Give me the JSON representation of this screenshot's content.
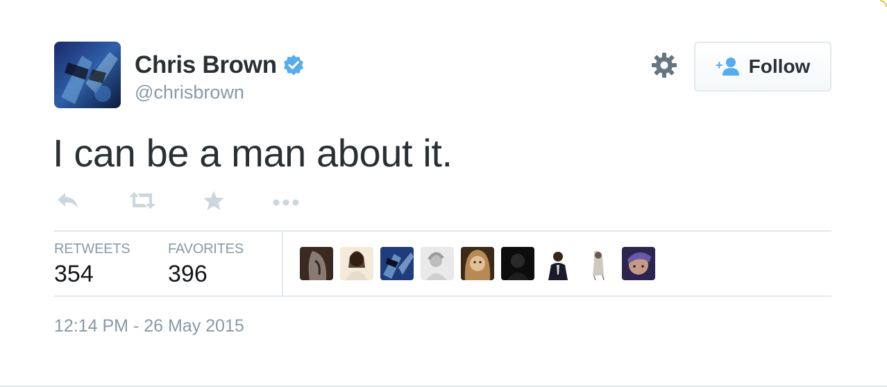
{
  "user": {
    "display_name": "Chris Brown",
    "handle": "@chrisbrown",
    "verified": true,
    "avatar_icon": "profile-photo"
  },
  "follow_button": {
    "label": "Follow",
    "icon": "add-user-icon"
  },
  "settings_icon": "gear-icon",
  "tweet": {
    "text": "I can be a man about it."
  },
  "actions": [
    {
      "name": "reply",
      "icon": "reply-icon"
    },
    {
      "name": "retweet",
      "icon": "retweet-icon"
    },
    {
      "name": "favorite",
      "icon": "star-icon"
    },
    {
      "name": "more",
      "icon": "more-icon"
    }
  ],
  "stats": {
    "retweets_label": "RETWEETS",
    "retweets_count": "354",
    "favorites_label": "FAVORITES",
    "favorites_count": "396"
  },
  "favoriters_count_shown": 9,
  "timestamp": "12:14 PM - 26 May 2015",
  "colors": {
    "text_primary": "#292f33",
    "text_secondary": "#8899a6",
    "verified_blue": "#55acee",
    "divider": "#e1e8ed"
  }
}
